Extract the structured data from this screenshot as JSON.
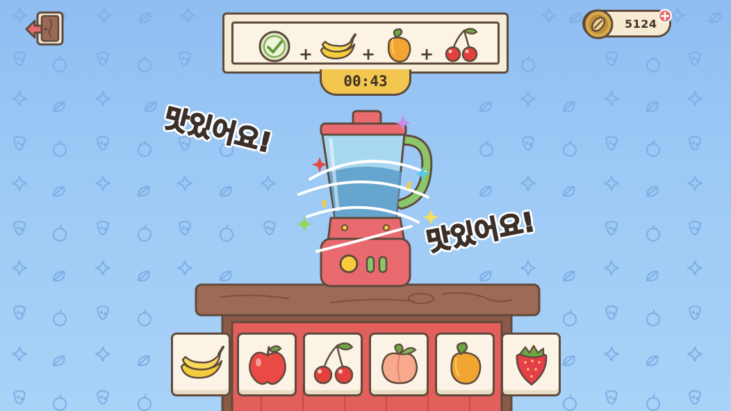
{
  "hud": {
    "coins": "5124",
    "timer": "00:43"
  },
  "recipe": {
    "steps": [
      "check-icon",
      "banana-icon",
      "mango-icon",
      "cherry-icon"
    ],
    "separator": "+"
  },
  "praise": {
    "left": "맛있어요!",
    "right": "맛있어요!"
  },
  "fruit_tray": [
    "banana",
    "apple",
    "cherry",
    "peach",
    "mango",
    "strawberry"
  ],
  "colors": {
    "background": "#9cc9f5",
    "blender_base": "#e86a6f",
    "blender_jar": "#6fb7db",
    "counter_wood": "#8a5a47",
    "timer_bg": "#f2c64f",
    "outline": "#5e4a3c"
  }
}
